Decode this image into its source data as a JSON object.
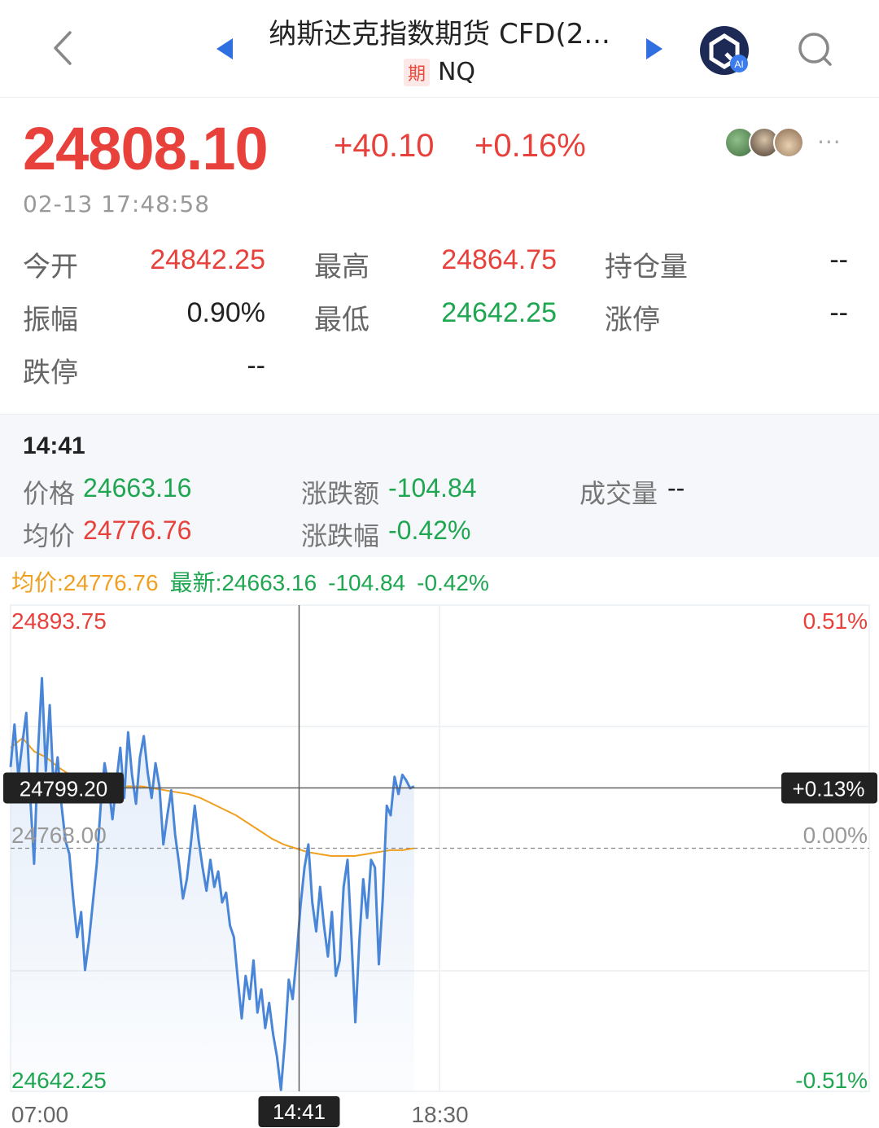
{
  "header": {
    "title": "纳斯达克指数期货 CFD(2...",
    "tag": "期",
    "symbol": "NQ",
    "ai_badge": "AI"
  },
  "quote": {
    "price": "24808.10",
    "change": "+40.10",
    "change_pct": "+0.16%",
    "more": "···",
    "timestamp": "02-13 17:48:58"
  },
  "stats": {
    "open_label": "今开",
    "open_value": "24842.25",
    "high_label": "最高",
    "high_value": "24864.75",
    "oi_label": "持仓量",
    "oi_value": "--",
    "amp_label": "振幅",
    "amp_value": "0.90%",
    "low_label": "最低",
    "low_value": "24642.25",
    "limit_up_label": "涨停",
    "limit_up_value": "--",
    "limit_down_label": "跌停",
    "limit_down_value": "--"
  },
  "crosshair": {
    "time": "14:41",
    "price_label": "价格",
    "price_value": "24663.16",
    "change_label": "涨跌额",
    "change_value": "-104.84",
    "volume_label": "成交量",
    "volume_value": "--",
    "avg_label": "均价",
    "avg_value": "24776.76",
    "pct_label": "涨跌幅",
    "pct_value": "-0.42%"
  },
  "legend": {
    "avg": "均价:24776.76",
    "latest": "最新:24663.16",
    "change": "-104.84",
    "pct": "-0.42%"
  },
  "colors": {
    "up": "#e8413b",
    "down": "#1ea651",
    "line": "#4a86d8",
    "avg": "#f0a020"
  },
  "chart_data": {
    "type": "line",
    "y_max_label": "24893.75",
    "y_mid_label": "24768.00",
    "y_min_label": "24642.25",
    "pct_max_label": "0.51%",
    "pct_mid_label": "0.00%",
    "pct_min_label": "-0.51%",
    "cursor_price_label": "24799.20",
    "cursor_pct_label": "+0.13%",
    "x_start": "07:00",
    "x_cursor": "14:41",
    "x_mid": "18:30",
    "ylim": [
      24642.25,
      24893.75
    ],
    "prev_close": 24768.0,
    "cursor_value": 24799.2,
    "cursor_fraction": 0.336,
    "mid_fraction": 0.5,
    "end_fraction": 0.47,
    "series": [
      {
        "values": [
          24810,
          24832,
          24805,
          24822,
          24838,
          24795,
          24760,
          24818,
          24856,
          24808,
          24842,
          24798,
          24815,
          24790,
          24772,
          24765,
          24742,
          24722,
          24735,
          24705,
          24720,
          24740,
          24760,
          24790,
          24812,
          24800,
          24783,
          24802,
          24820,
          24794,
          24828,
          24806,
          24791,
          24815,
          24826,
          24807,
          24794,
          24812,
          24800,
          24770,
          24785,
          24798,
          24775,
          24760,
          24742,
          24752,
          24770,
          24790,
          24772,
          24758,
          24746,
          24762,
          24748,
          24756,
          24740,
          24745,
          24728,
          24722,
          24700,
          24680,
          24702,
          24690,
          24710,
          24683,
          24695,
          24675,
          24688,
          24672,
          24660,
          24643,
          24668,
          24700,
          24690,
          24712,
          24738,
          24758,
          24770,
          24740,
          24725,
          24748,
          24728,
          24712,
          24735,
          24702,
          24710,
          24748,
          24762,
          24722,
          24678,
          24720,
          24752,
          24732,
          24762,
          24758,
          24708,
          24742,
          24790,
          24785,
          24805,
          24796,
          24806,
          24803,
          24799,
          24800
        ],
        "avg": [
          24820,
          24825,
          24818,
          24815,
          24810,
          24806,
          24803,
          24802,
          24801,
          24800,
          24800,
          24800,
          24799,
          24798,
          24797,
          24796,
          24794,
          24791,
          24788,
          24785,
          24781,
          24777,
          24773,
          24770,
          24768,
          24766,
          24765,
          24764,
          24764,
          24764,
          24765,
          24766,
          24767,
          24767,
          24768
        ]
      }
    ]
  }
}
